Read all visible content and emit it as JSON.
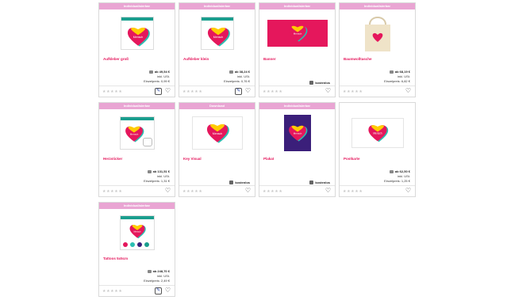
{
  "brand_colors": {
    "banner": "#e9a5d3",
    "title": "#e5175c",
    "heart_top": "#ffcc00",
    "heart_mid": "#e5175c",
    "heart_back": "#2bbfb2"
  },
  "products": [
    {
      "banner": "Individualisierbar",
      "title": "Aufkleber groß",
      "price": "ab 49,54 €",
      "vat": "inkl. USt.",
      "unit": "Einzelpreis: 0,99 €",
      "vendor": "",
      "stars": "★★★★★",
      "edit": true,
      "image": "sticker-sheet-icon"
    },
    {
      "banner": "Individualisierbar",
      "title": "Aufkleber klein",
      "price": "ab 38,24 €",
      "vat": "inkl. USt.",
      "unit": "Einzelpreis: 0,76 €",
      "vendor": "",
      "stars": "★★★★★",
      "edit": true,
      "image": "sticker-sheet-icon"
    },
    {
      "banner": "Individualisierbar",
      "title": "Banner",
      "price": "",
      "vat": "",
      "unit": "",
      "vendor": "kostenlos",
      "stars": "★★★★★",
      "edit": false,
      "image": "banner-icon"
    },
    {
      "banner": "Individualisierbar",
      "title": "Baumwolltasche",
      "price": "ab 68,19 €",
      "vat": "inkl. USt.",
      "unit": "Einzelpreis: 6,82 €",
      "vendor": "",
      "stars": "★★★★★",
      "edit": false,
      "image": "tote-bag-icon"
    },
    {
      "banner": "Individualisierbar",
      "title": "Herzsticker",
      "price": "ab 131,51 €",
      "vat": "inkl. USt.",
      "unit": "Einzelpreis: 1,31 €",
      "vendor": "",
      "stars": "★★★★★",
      "edit": false,
      "image": "heart-sticker-icon"
    },
    {
      "banner": "Download",
      "title": "Key Visual",
      "price": "",
      "vat": "",
      "unit": "",
      "vendor": "kostenlos",
      "stars": "★★★★★",
      "edit": false,
      "image": "key-visual-icon"
    },
    {
      "banner": "Individualisierbar",
      "title": "Plakat",
      "price": "",
      "vat": "",
      "unit": "",
      "vendor": "kostenlos",
      "stars": "★★★★★",
      "edit": false,
      "image": "poster-icon"
    },
    {
      "banner": "",
      "title": "Postkarte",
      "price": "ab 62,50 €",
      "vat": "inkl. USt.",
      "unit": "Einzelpreis: 1,25 €",
      "vendor": "",
      "stars": "★★★★★",
      "edit": false,
      "image": "postcard-icon"
    },
    {
      "banner": "Individualisierbar",
      "title": "Tattoos 5x5cm",
      "price": "ab 248,70 €",
      "vat": "inkl. USt.",
      "unit": "Einzelpreis: 2,49 €",
      "vendor": "",
      "stars": "★★★★★",
      "edit": true,
      "image": "tattoo-sheet-icon"
    }
  ]
}
